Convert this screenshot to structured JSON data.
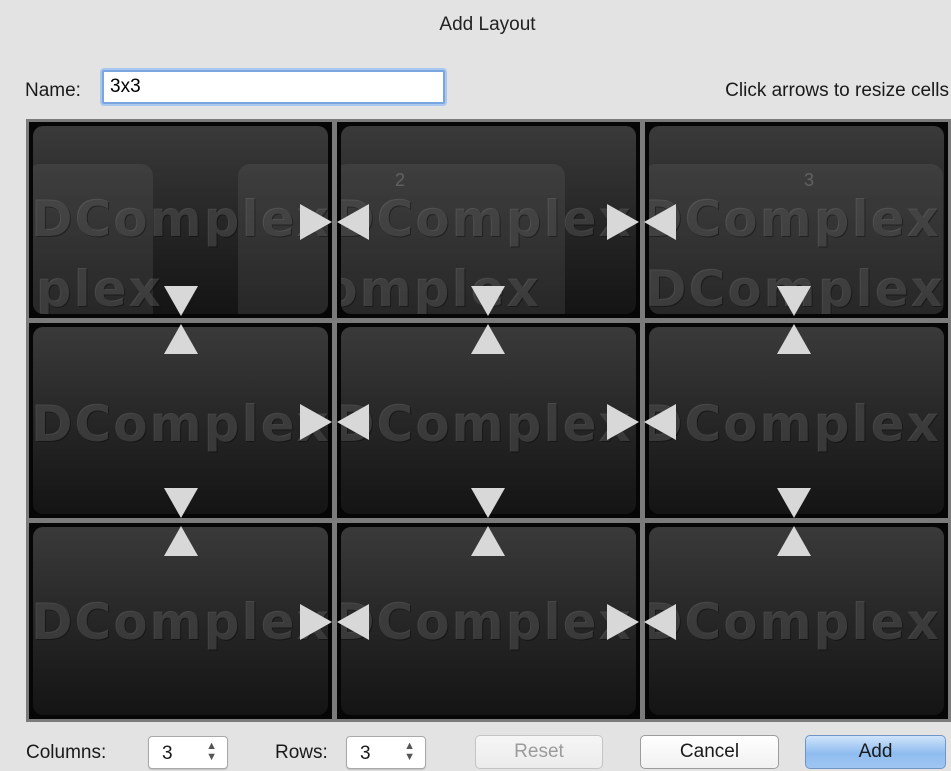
{
  "window": {
    "title": "Add Layout"
  },
  "name_field": {
    "label": "Name:",
    "value": "3x3"
  },
  "hint": "Click arrows to resize cells",
  "grid": {
    "columns": 3,
    "rows": 3,
    "watermark_text": "DComplex",
    "cells": [
      {
        "id": "r1c1"
      },
      {
        "id": "r1c2",
        "number": "2"
      },
      {
        "id": "r1c3",
        "number": "3"
      },
      {
        "id": "r2c1"
      },
      {
        "id": "r2c2"
      },
      {
        "id": "r2c3"
      },
      {
        "id": "r3c1"
      },
      {
        "id": "r3c2"
      },
      {
        "id": "r3c3"
      }
    ]
  },
  "footer": {
    "columns_label": "Columns:",
    "columns_value": "3",
    "rows_label": "Rows:",
    "rows_value": "3",
    "reset_label": "Reset",
    "cancel_label": "Cancel",
    "add_label": "Add",
    "stepper_icon": "up-down-arrows"
  },
  "colors": {
    "accent": "#8fbcef",
    "focus_ring": "#7aa6e0",
    "grid_border": "#7b7b7b"
  }
}
